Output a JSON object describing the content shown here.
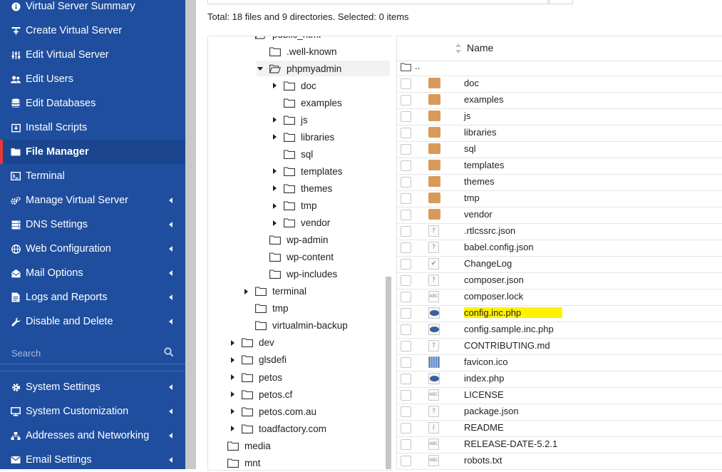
{
  "sidebar": {
    "items": [
      {
        "label": "Virtual Server Summary",
        "icon": "info-icon",
        "has_submenu": false,
        "active": false
      },
      {
        "label": "Create Virtual Server",
        "icon": "create-server-icon",
        "has_submenu": false,
        "active": false
      },
      {
        "label": "Edit Virtual Server",
        "icon": "sliders-icon",
        "has_submenu": false,
        "active": false
      },
      {
        "label": "Edit Users",
        "icon": "users-icon",
        "has_submenu": false,
        "active": false
      },
      {
        "label": "Edit Databases",
        "icon": "database-icon",
        "has_submenu": false,
        "active": false
      },
      {
        "label": "Install Scripts",
        "icon": "install-icon",
        "has_submenu": false,
        "active": false
      },
      {
        "label": "File Manager",
        "icon": "folder-icon",
        "has_submenu": false,
        "active": true
      },
      {
        "label": "Terminal",
        "icon": "terminal-icon",
        "has_submenu": false,
        "active": false
      },
      {
        "label": "Manage Virtual Server",
        "icon": "cogs-icon",
        "has_submenu": true,
        "active": false
      },
      {
        "label": "DNS Settings",
        "icon": "server-icon",
        "has_submenu": true,
        "active": false
      },
      {
        "label": "Web Configuration",
        "icon": "globe-icon",
        "has_submenu": true,
        "active": false
      },
      {
        "label": "Mail Options",
        "icon": "mail-icon",
        "has_submenu": true,
        "active": false
      },
      {
        "label": "Logs and Reports",
        "icon": "report-icon",
        "has_submenu": true,
        "active": false
      },
      {
        "label": "Disable and Delete",
        "icon": "wrench-icon",
        "has_submenu": true,
        "active": false
      }
    ],
    "search_placeholder": "Search",
    "items2": [
      {
        "label": "System Settings",
        "icon": "gear-icon",
        "has_submenu": true
      },
      {
        "label": "System Customization",
        "icon": "desktop-icon",
        "has_submenu": true
      },
      {
        "label": "Addresses and Networking",
        "icon": "network-icon",
        "has_submenu": true
      },
      {
        "label": "Email Settings",
        "icon": "envelope-icon",
        "has_submenu": true
      }
    ]
  },
  "summary": "Total: 18 files and 9 directories. Selected: 0 items",
  "tree": [
    {
      "label": "public_html",
      "depth": 3,
      "expanded": true,
      "has_children": true,
      "partial": true
    },
    {
      "label": ".well-known",
      "depth": 4,
      "has_children": false
    },
    {
      "label": "phpmyadmin",
      "depth": 4,
      "expanded": true,
      "has_children": true,
      "selected": true
    },
    {
      "label": "doc",
      "depth": 5,
      "has_children": true
    },
    {
      "label": "examples",
      "depth": 5,
      "has_children": false
    },
    {
      "label": "js",
      "depth": 5,
      "has_children": true
    },
    {
      "label": "libraries",
      "depth": 5,
      "has_children": true
    },
    {
      "label": "sql",
      "depth": 5,
      "has_children": false
    },
    {
      "label": "templates",
      "depth": 5,
      "has_children": true
    },
    {
      "label": "themes",
      "depth": 5,
      "has_children": true
    },
    {
      "label": "tmp",
      "depth": 5,
      "has_children": true
    },
    {
      "label": "vendor",
      "depth": 5,
      "has_children": true
    },
    {
      "label": "wp-admin",
      "depth": 4,
      "has_children": false
    },
    {
      "label": "wp-content",
      "depth": 4,
      "has_children": false
    },
    {
      "label": "wp-includes",
      "depth": 4,
      "has_children": false
    },
    {
      "label": "terminal",
      "depth": 3,
      "has_children": true
    },
    {
      "label": "tmp",
      "depth": 3,
      "has_children": false
    },
    {
      "label": "virtualmin-backup",
      "depth": 3,
      "has_children": false
    },
    {
      "label": "dev",
      "depth": 2,
      "has_children": true
    },
    {
      "label": "glsdefi",
      "depth": 2,
      "has_children": true
    },
    {
      "label": "petos",
      "depth": 2,
      "has_children": true
    },
    {
      "label": "petos.cf",
      "depth": 2,
      "has_children": true
    },
    {
      "label": "petos.com.au",
      "depth": 2,
      "has_children": true
    },
    {
      "label": "toadfactory.com",
      "depth": 2,
      "has_children": true
    },
    {
      "label": "media",
      "depth": 1,
      "has_children": false
    },
    {
      "label": "mnt",
      "depth": 1,
      "has_children": false
    }
  ],
  "list": {
    "column_name": "Name",
    "updir": "..",
    "files": [
      {
        "name": "doc",
        "type": "folder"
      },
      {
        "name": "examples",
        "type": "folder"
      },
      {
        "name": "js",
        "type": "folder"
      },
      {
        "name": "libraries",
        "type": "folder"
      },
      {
        "name": "sql",
        "type": "folder"
      },
      {
        "name": "templates",
        "type": "folder"
      },
      {
        "name": "themes",
        "type": "folder"
      },
      {
        "name": "tmp",
        "type": "folder"
      },
      {
        "name": "vendor",
        "type": "folder"
      },
      {
        "name": ".rtlcssrc.json",
        "type": "unknown"
      },
      {
        "name": "babel.config.json",
        "type": "unknown"
      },
      {
        "name": "ChangeLog",
        "type": "check"
      },
      {
        "name": "composer.json",
        "type": "unknown"
      },
      {
        "name": "composer.lock",
        "type": "text"
      },
      {
        "name": "config.inc.php",
        "type": "php",
        "highlight": true
      },
      {
        "name": "config.sample.inc.php",
        "type": "php"
      },
      {
        "name": "CONTRIBUTING.md",
        "type": "unknown"
      },
      {
        "name": "favicon.ico",
        "type": "image"
      },
      {
        "name": "index.php",
        "type": "php"
      },
      {
        "name": "LICENSE",
        "type": "text"
      },
      {
        "name": "package.json",
        "type": "unknown"
      },
      {
        "name": "README",
        "type": "info"
      },
      {
        "name": "RELEASE-DATE-5.2.1",
        "type": "text"
      },
      {
        "name": "robots.txt",
        "type": "text"
      }
    ]
  }
}
